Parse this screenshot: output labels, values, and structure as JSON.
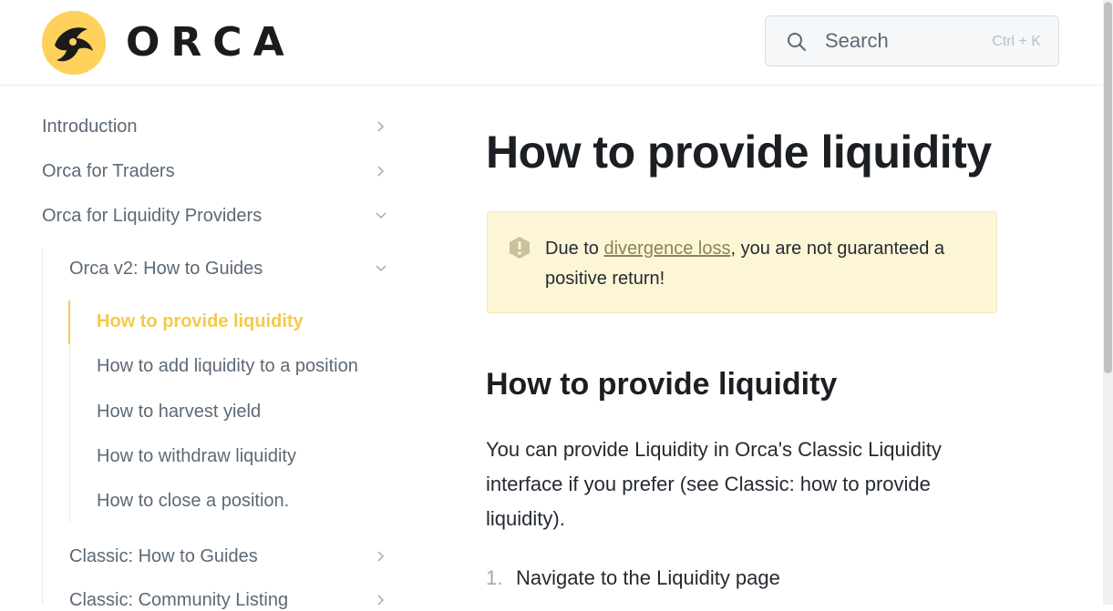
{
  "header": {
    "brand": "ORCA",
    "search": {
      "placeholder": "Search",
      "shortcut": "Ctrl + K"
    }
  },
  "sidebar": {
    "items": [
      {
        "label": "Introduction",
        "expanded": false
      },
      {
        "label": "Orca for Traders",
        "expanded": false
      },
      {
        "label": "Orca for Liquidity Providers",
        "expanded": true
      }
    ],
    "subgroup": {
      "label": "Orca v2: How to Guides",
      "expanded": true
    },
    "pages": [
      {
        "label": "How to provide liquidity",
        "active": true
      },
      {
        "label": "How to add liquidity to a position"
      },
      {
        "label": "How to harvest yield"
      },
      {
        "label": "How to withdraw liquidity"
      },
      {
        "label": "How to close a position."
      }
    ],
    "more_groups": [
      {
        "label": "Classic: How to Guides",
        "expanded": false
      },
      {
        "label": "Classic: Community Listing",
        "expanded": false
      }
    ]
  },
  "main": {
    "title": "How to provide liquidity",
    "hint": {
      "prefix": "Due to ",
      "link": "divergence loss",
      "suffix": ", you are not guaranteed a positive return!"
    },
    "section_heading": "How to provide liquidity",
    "paragraph": "You can provide Liquidity in Orca's Classic Liquidity interface if you prefer (see Classic: how to provide liquidity).",
    "steps": [
      {
        "num": "1.",
        "text": "Navigate to the Liquidity page"
      }
    ]
  },
  "colors": {
    "accent": "#f5c94a",
    "hint_bg": "#fcf6d6",
    "text": "#242a31",
    "muted": "#5c6975"
  }
}
